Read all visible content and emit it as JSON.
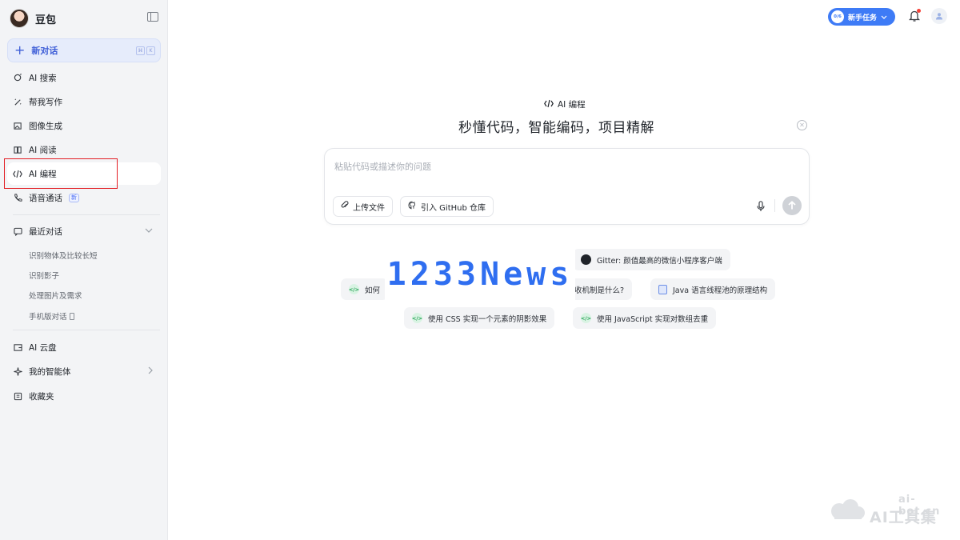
{
  "brand": {
    "name": "豆包"
  },
  "sidebar": {
    "new_chat": {
      "label": "新对话",
      "keys": [
        "⌘",
        "K"
      ]
    },
    "items": [
      {
        "label": "AI 搜索",
        "icon": "search-icon"
      },
      {
        "label": "帮我写作",
        "icon": "pen-icon"
      },
      {
        "label": "图像生成",
        "icon": "image-icon"
      },
      {
        "label": "AI 阅读",
        "icon": "book-icon"
      },
      {
        "label": "AI 编程",
        "icon": "code-icon"
      },
      {
        "label": "语音通话",
        "icon": "phone-icon",
        "badge": "新"
      }
    ],
    "recent": {
      "title": "最近对话",
      "items": [
        "识别物体及比较长短",
        "识别影子",
        "处理图片及需求",
        "手机版对话"
      ]
    },
    "bottom": [
      {
        "label": "AI 云盘",
        "icon": "cloud-drive-icon"
      },
      {
        "label": "我的智能体",
        "icon": "sparkle-icon"
      },
      {
        "label": "收藏夹",
        "icon": "favorites-icon"
      }
    ]
  },
  "header": {
    "task_button": {
      "progress": "0/6",
      "label": "新手任务"
    }
  },
  "main": {
    "mode": "AI 编程",
    "headline": "秒懂代码，智能编码，项目精解",
    "composer": {
      "placeholder": "粘贴代码或描述你的问题",
      "upload_label": "上传文件",
      "github_label": "引入 GitHub 仓库"
    },
    "suggestions": [
      {
        "label": "Gitter: 颜值最高的微信小程序客户端",
        "icon": "github-icon"
      },
      {
        "label": "如何",
        "icon": "code-icon"
      },
      {
        "label": "收机制是什么?",
        "icon": "code-icon"
      },
      {
        "label": "Java 语言线程池的原理结构",
        "icon": "doc-icon"
      },
      {
        "label": "使用 CSS 实现一个元素的阴影效果",
        "icon": "code-icon"
      },
      {
        "label": "使用 JavaScript 实现对数组去重",
        "icon": "code-icon"
      }
    ]
  },
  "watermarks": {
    "news": "1233News",
    "site": "ai-bot.cn",
    "site_name": "AI工具集"
  },
  "colors": {
    "accent": "#3e7bf6",
    "highlight": "#e31e24",
    "sidebar_bg": "#f3f4f6"
  }
}
